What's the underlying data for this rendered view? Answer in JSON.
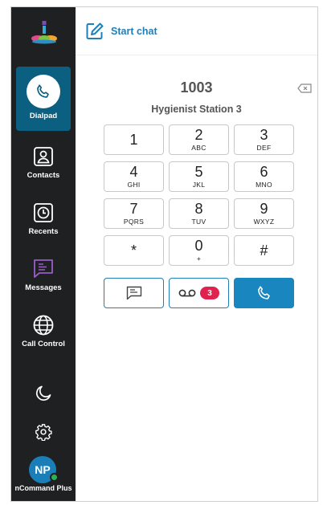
{
  "sidebar": {
    "items": [
      {
        "label": "Dialpad",
        "icon": "phone-icon",
        "active": true
      },
      {
        "label": "Contacts",
        "icon": "contact-card-icon"
      },
      {
        "label": "Recents",
        "icon": "clock-icon"
      },
      {
        "label": "Messages",
        "icon": "message-icon"
      },
      {
        "label": "Call Control",
        "icon": "globe-icon"
      }
    ],
    "theme_icon": "moon-icon",
    "settings_icon": "gear-icon",
    "user": {
      "initials": "NP",
      "name": "nCommand Plus",
      "presence_color": "#2bb24c"
    }
  },
  "header": {
    "start_chat_label": "Start chat",
    "icon": "compose-icon"
  },
  "dialer": {
    "number": "1003",
    "contact_name": "Hygienist Station 3",
    "keys": [
      {
        "digit": "1",
        "letters": ""
      },
      {
        "digit": "2",
        "letters": "ABC"
      },
      {
        "digit": "3",
        "letters": "DEF"
      },
      {
        "digit": "4",
        "letters": "GHI"
      },
      {
        "digit": "5",
        "letters": "JKL"
      },
      {
        "digit": "6",
        "letters": "MNO"
      },
      {
        "digit": "7",
        "letters": "PQRS"
      },
      {
        "digit": "8",
        "letters": "TUV"
      },
      {
        "digit": "9",
        "letters": "WXYZ"
      },
      {
        "digit": "*",
        "letters": ""
      },
      {
        "digit": "0",
        "letters": "+"
      },
      {
        "digit": "#",
        "letters": ""
      }
    ],
    "voicemail_count": "3"
  },
  "colors": {
    "sidebar_bg": "#1f2022",
    "active_nav": "#0b5f80",
    "accent": "#1a86c0",
    "badge": "#e0234e"
  }
}
